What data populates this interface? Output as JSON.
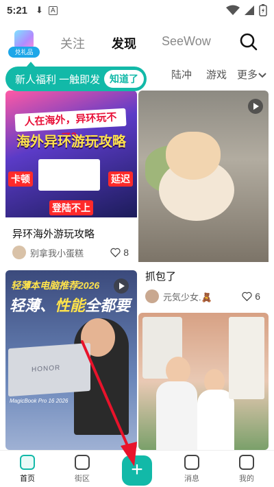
{
  "status_bar": {
    "time": "5:21",
    "download_icon": "download-icon",
    "app_icon": "a-icon",
    "wifi_icon": "wifi-icon",
    "signal_icon": "signal-icon",
    "battery_icon": "battery-icon"
  },
  "top_nav": {
    "gift_label": "兑礼品",
    "tabs": [
      {
        "label": "关注",
        "active": false
      },
      {
        "label": "发现",
        "active": true
      },
      {
        "label": "SeeWow",
        "active": false
      }
    ],
    "search_icon": "search-icon"
  },
  "categories": {
    "items": [
      "陆冲",
      "游戏"
    ],
    "more_label": "更多"
  },
  "tooltip": {
    "text": "新人福利 一触即发",
    "button_label": "知道了"
  },
  "feed": [
    {
      "title": "异环海外游玩攻略",
      "author": "别拿我小蛋糕",
      "likes": "8",
      "poster": {
        "headline": "人在海外，异环玩不了？",
        "title": "海外异环游玩攻略",
        "tags": [
          "卡顿",
          "延迟",
          "登陆不上"
        ]
      }
    },
    {
      "title": "抓包了",
      "author": "元気少女.🧸",
      "likes": "6"
    },
    {
      "poster": {
        "top": "轻薄本电脑推荐2026",
        "main_a": "轻薄、",
        "main_b": "性能",
        "main_c": "全都要",
        "laptop_brand": "HONOR",
        "model": "MagicBook Pro 16 2026"
      }
    },
    {}
  ],
  "bottom_nav": {
    "items": [
      {
        "label": "首页",
        "active": true
      },
      {
        "label": "街区",
        "active": false
      },
      {
        "label": "消息",
        "active": false
      },
      {
        "label": "我的",
        "active": false
      }
    ],
    "plus_label": "+"
  },
  "colors": {
    "accent": "#12b9a8",
    "arrow": "#e8132b"
  }
}
